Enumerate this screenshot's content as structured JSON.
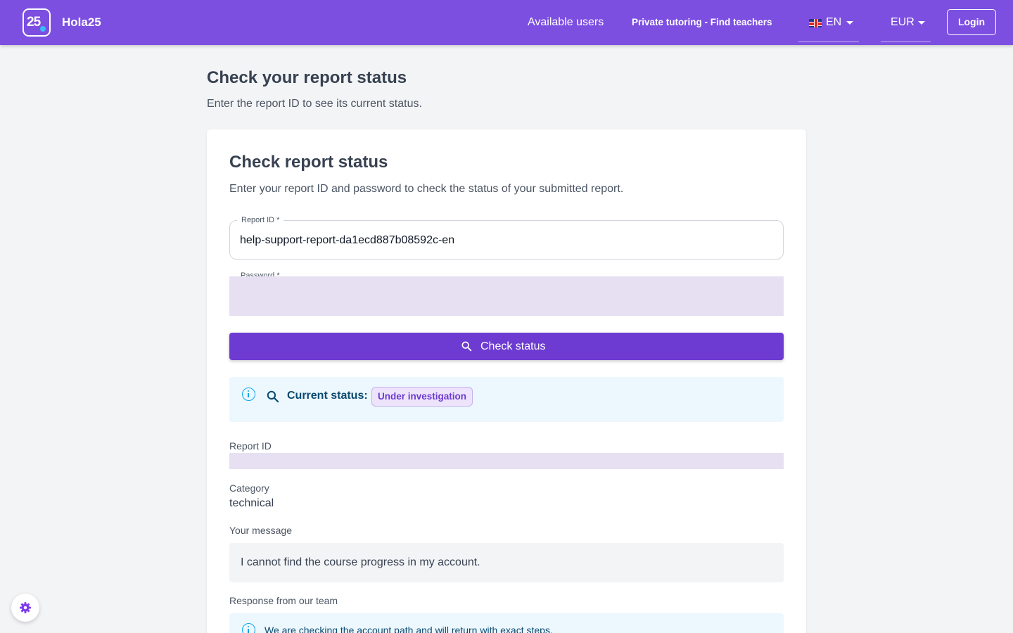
{
  "header": {
    "brand": "Hola25",
    "logo_text": "25",
    "nav": {
      "available_users": "Available users",
      "private_tutoring": "Private tutoring - Find teachers"
    },
    "language": {
      "flag_icon": "uk-flag-icon",
      "label": "EN"
    },
    "currency": {
      "label": "EUR"
    },
    "login_label": "Login"
  },
  "page": {
    "title": "Check your report status",
    "subtitle": "Enter the report ID to see its current status."
  },
  "card": {
    "title": "Check report status",
    "subtitle": "Enter your report ID and password to check the status of your submitted report.",
    "report_id_field": {
      "label": "Report ID *",
      "value": "help-support-report-da1ecd887b08592c-en"
    },
    "password_field": {
      "label": "Password *",
      "value": ""
    },
    "check_button": {
      "label": "Check status",
      "icon": "search-icon"
    }
  },
  "status": {
    "label": "Current status:",
    "badge": "Under investigation",
    "icons": [
      "info-icon",
      "search-icon"
    ]
  },
  "details": {
    "report_id_label": "Report ID",
    "category_label": "Category",
    "category_value": "technical",
    "message_label": "Your message",
    "message_value": "I cannot find the course progress in my account.",
    "response_label": "Response from our team",
    "response_value": "We are checking the account path and will return with exact steps."
  },
  "colors": {
    "header_bg": "#7c4fe0",
    "primary_button": "#6d3bd1",
    "info_bg": "#ecf7fe",
    "info_accent": "#0ea5e9",
    "badge_bg": "#ede4fb",
    "badge_text": "#6d3bd1",
    "page_bg": "#f3f4f6"
  },
  "settings_fab": {
    "icon": "gear-icon"
  }
}
